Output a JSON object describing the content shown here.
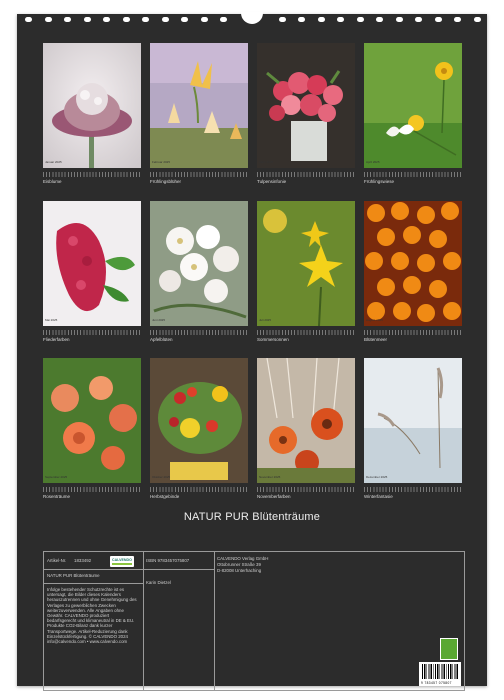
{
  "title": "NATUR PUR  Blütenträume",
  "months": [
    {
      "date": "Januar 2025",
      "caption": "Eisblume"
    },
    {
      "date": "Februar 2025",
      "caption": "Frühlingsblüher"
    },
    {
      "date": "März 2025",
      "caption": "Tulpensinfonie"
    },
    {
      "date": "April 2025",
      "caption": "Frühlingswiese"
    },
    {
      "date": "Mai 2025",
      "caption": "Fliederfarben"
    },
    {
      "date": "Juni 2025",
      "caption": "Apfelblüten"
    },
    {
      "date": "Juli 2025",
      "caption": "Sommersonnen"
    },
    {
      "date": "August 2025",
      "caption": "Blütenmeer"
    },
    {
      "date": "September 2025",
      "caption": "Rosenträume"
    },
    {
      "date": "Oktober 2025",
      "caption": "Herbstgebinde"
    },
    {
      "date": "November 2025",
      "caption": "Novemberfarben"
    },
    {
      "date": "Dezember 2025",
      "caption": "Winterfantasie"
    }
  ],
  "info": {
    "article_label": "Artikel-Nr.",
    "article_no": "1833492",
    "product": "NATUR PUR  Blütenträume",
    "calvendo_logo": "CALVENDO",
    "legal": "Infolge bestehender Schutzrechte ist es untersagt, die Bilder dieses Kalenders herauszutrennen und ohne Genehmigung des Verlages zu gewerblichen Zwecken weiterzuverwenden. Alle Angaben ohne Gewähr. CALVENDO produziert bedarfsgerecht und klimaneutral in DE & EU. Produkte CO2-Bilanz dank kurzer Transportwege. Artikel-Reduzierung dank Einzelstückfertigung. © CALVENDO 2024 info@calvendo.com • www.calvendo.com",
    "isbn": "ISBN 9783457075807",
    "author": "Karin Dietzel",
    "publisher_line1": "CALVENDO Verlag GmbH",
    "publisher_line2": "Ottobrunner Straße 39",
    "publisher_line3": "D-82008 Unterhaching",
    "barcode_digits": "9 783457 075807"
  },
  "colors": {
    "page_background": "#2c2c2c",
    "caption_text": "#dcdcdc",
    "frame": "#9a9a9a",
    "badge_green": "#5aa832"
  }
}
